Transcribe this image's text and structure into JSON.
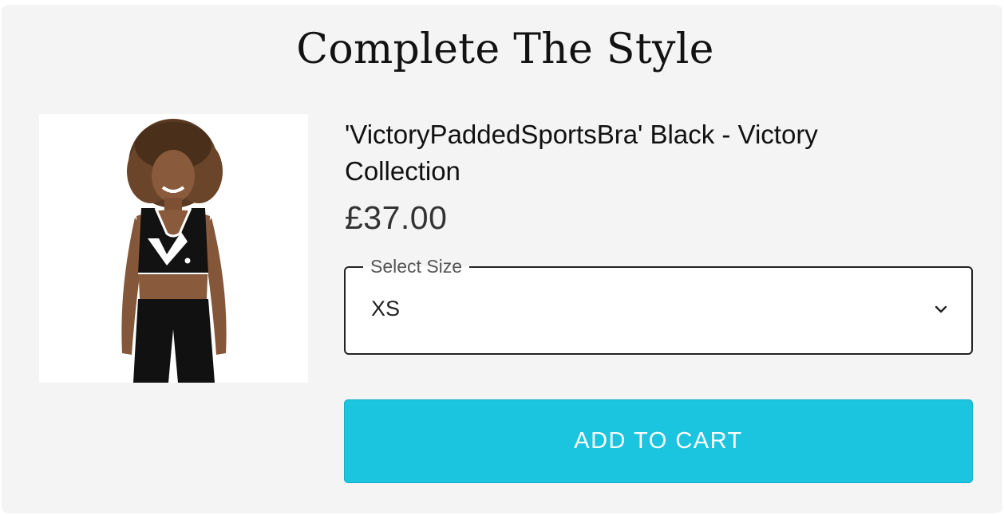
{
  "section": {
    "title": "Complete The Style"
  },
  "product": {
    "name": "'VictoryPaddedSportsBra' Black - Victory Collection",
    "price": "£37.00",
    "image_alt": "Model wearing black Victory padded sports bra and black leggings"
  },
  "size_select": {
    "label": "Select Size",
    "value": "XS"
  },
  "actions": {
    "add_to_cart_label": "ADD TO CART"
  },
  "colors": {
    "panel_background": "#f4f4f5",
    "button_accent": "#1bc4df",
    "text_dark": "#111111"
  },
  "icons": {
    "dropdown": "chevron-down-icon"
  }
}
